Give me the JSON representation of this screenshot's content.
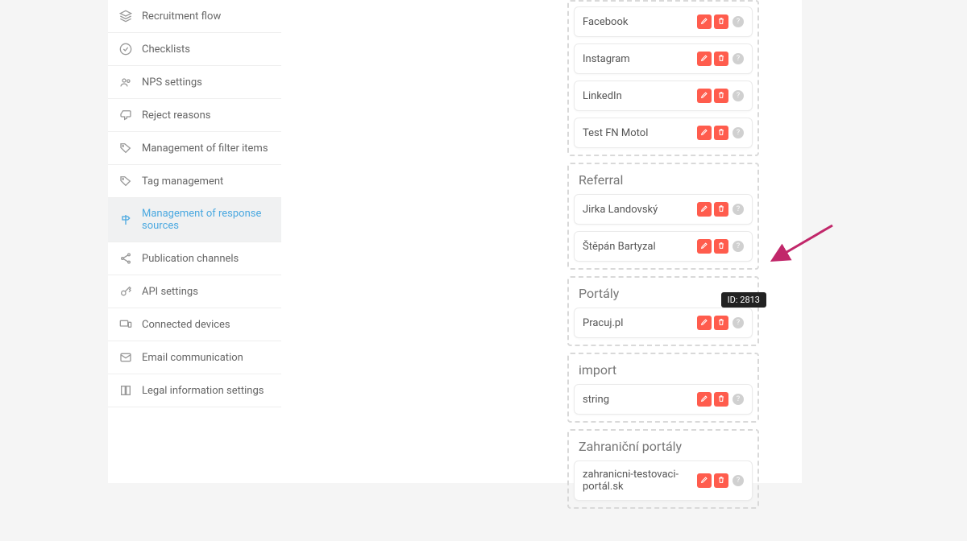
{
  "sidebar": {
    "items": [
      {
        "label": "Recruitment flow",
        "icon": "layers-icon"
      },
      {
        "label": "Checklists",
        "icon": "check-circle-icon"
      },
      {
        "label": "NPS settings",
        "icon": "people-icon"
      },
      {
        "label": "Reject reasons",
        "icon": "thumbs-down-icon"
      },
      {
        "label": "Management of filter items",
        "icon": "tag-icon"
      },
      {
        "label": "Tag management",
        "icon": "price-tag-icon"
      },
      {
        "label": "Management of response sources",
        "icon": "signpost-icon",
        "active": true
      },
      {
        "label": "Publication channels",
        "icon": "share-icon"
      },
      {
        "label": "API settings",
        "icon": "key-icon"
      },
      {
        "label": "Connected devices",
        "icon": "devices-icon"
      },
      {
        "label": "Email communication",
        "icon": "mail-icon"
      },
      {
        "label": "Legal information settings",
        "icon": "book-icon"
      }
    ]
  },
  "groups": [
    {
      "title": null,
      "rows": [
        {
          "label": "Facebook"
        },
        {
          "label": "Instagram"
        },
        {
          "label": "LinkedIn"
        },
        {
          "label": "Test FN Motol"
        }
      ]
    },
    {
      "title": "Referral",
      "rows": [
        {
          "label": "Jirka Landovský"
        },
        {
          "label": "Štěpán Bartyzal"
        }
      ]
    },
    {
      "title": "Portály",
      "rows": [
        {
          "label": "Pracuj.pl",
          "tooltip": "ID: 2813"
        }
      ]
    },
    {
      "title": "import",
      "rows": [
        {
          "label": "string"
        }
      ]
    },
    {
      "title": "Zahraniční portály",
      "rows": [
        {
          "label": "zahranicni-testovaci-portál.sk"
        }
      ]
    }
  ],
  "info_char": "?"
}
